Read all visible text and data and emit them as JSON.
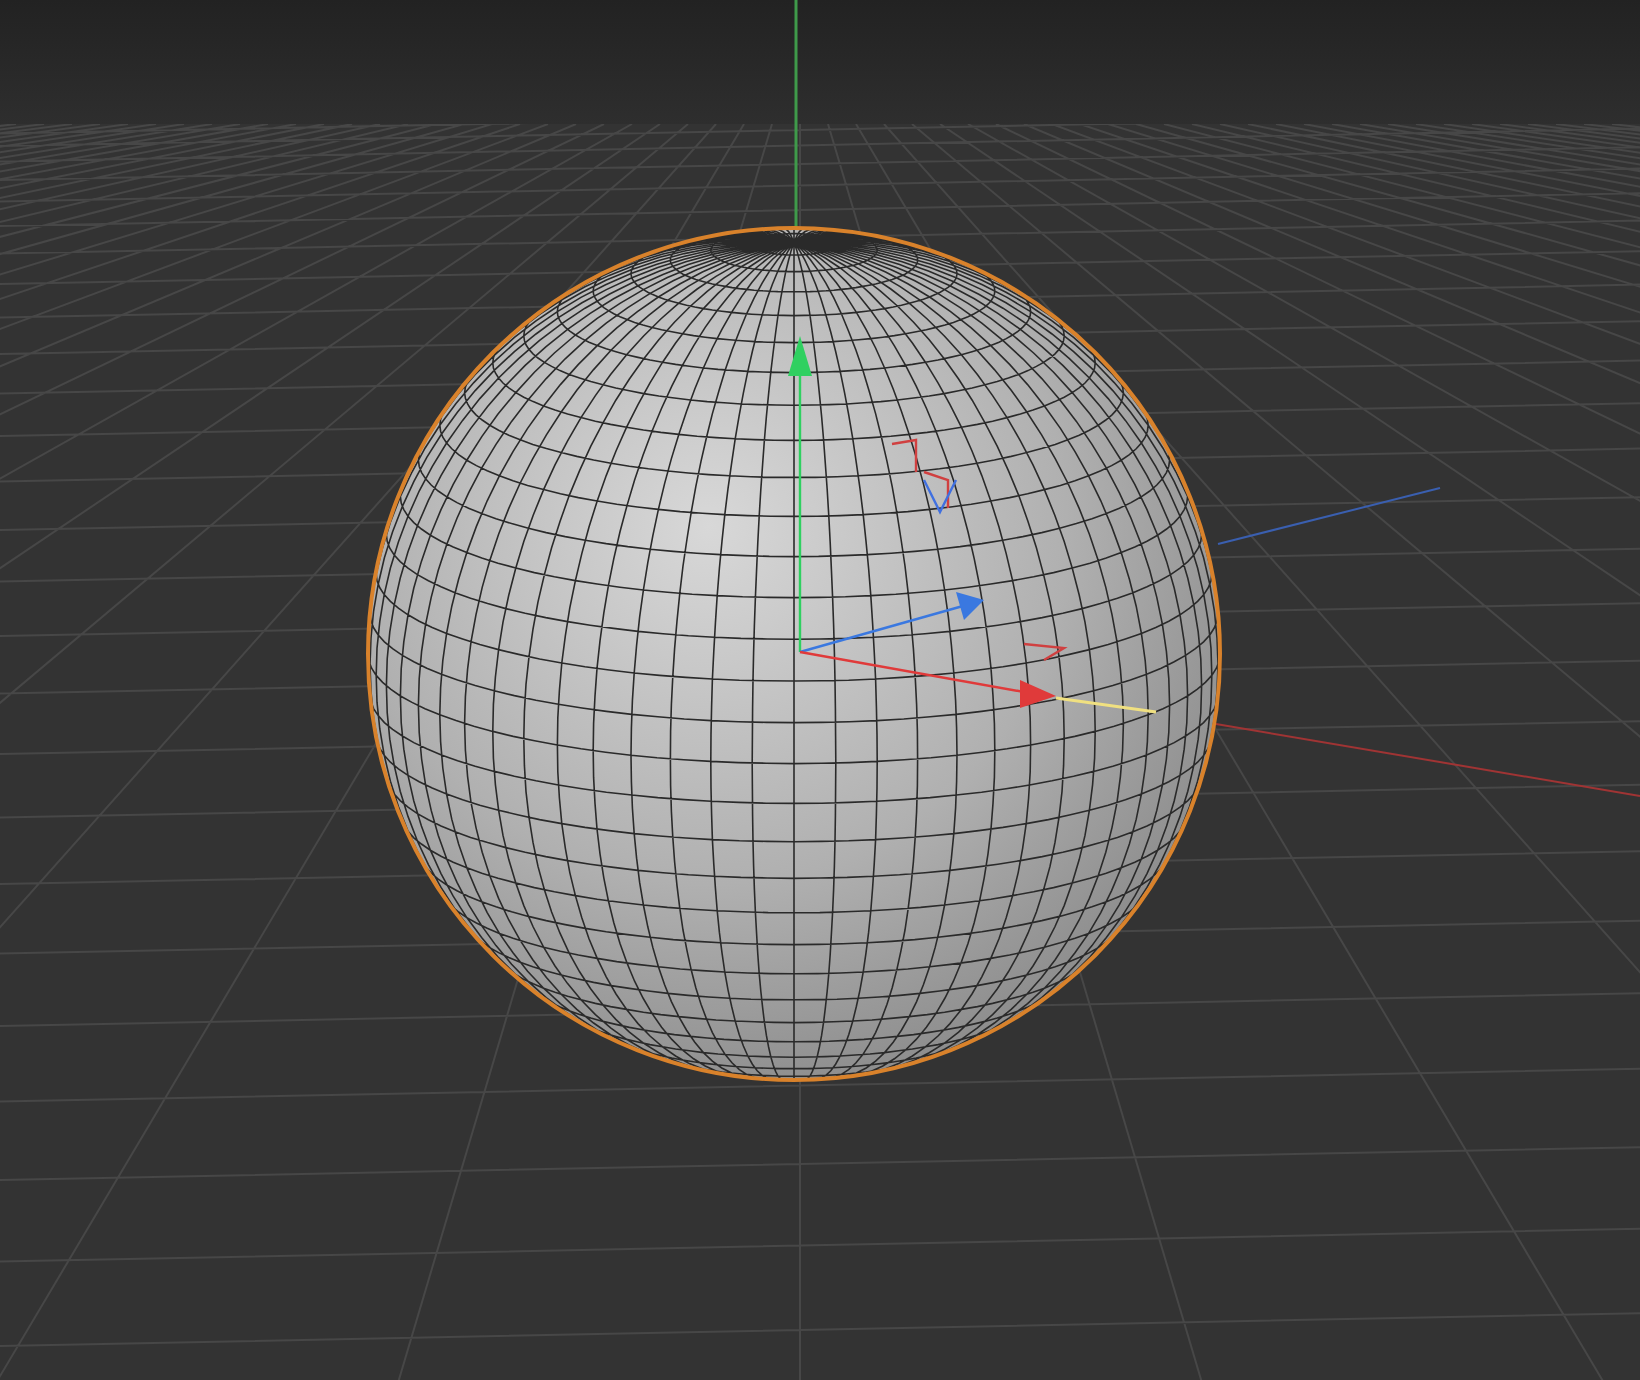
{
  "scene": {
    "objects": [
      {
        "kind": "sphere",
        "selected": true
      }
    ]
  }
}
